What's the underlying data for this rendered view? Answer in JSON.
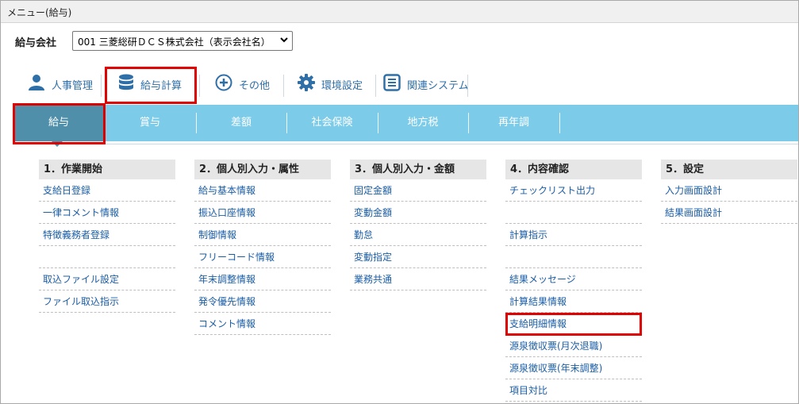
{
  "window": {
    "title": "メニュー(給与)"
  },
  "company": {
    "label": "給与会社",
    "selected": "001 三菱総研ＤＣＳ株式会社（表示会社名）"
  },
  "nav": [
    {
      "label": "人事管理",
      "icon": "person-icon"
    },
    {
      "label": "給与計算",
      "icon": "database-icon"
    },
    {
      "label": "その他",
      "icon": "plus-circle-icon"
    },
    {
      "label": "環境設定",
      "icon": "gear-icon"
    },
    {
      "label": "関連システム",
      "icon": "list-box-icon"
    }
  ],
  "tabs": [
    "給与",
    "賞与",
    "差額",
    "社会保険",
    "地方税",
    "再年調"
  ],
  "columns": [
    {
      "title": "1．作業開始",
      "items": [
        "支給日登録",
        "一律コメント情報",
        "特徴義務者登録",
        "",
        "取込ファイル設定",
        "ファイル取込指示"
      ]
    },
    {
      "title": "2．個人別入力・属性",
      "items": [
        "給与基本情報",
        "振込口座情報",
        "制御情報",
        "フリーコード情報",
        "年末調整情報",
        "発令優先情報",
        "コメント情報"
      ]
    },
    {
      "title": "3．個人別入力・金額",
      "items": [
        "固定金額",
        "変動金額",
        "勤怠",
        "変動指定",
        "業務共通"
      ]
    },
    {
      "title": "4．内容確認",
      "items": [
        "チェックリスト出力",
        "",
        "計算指示",
        "",
        "結果メッセージ",
        "計算結果情報",
        "支給明細情報",
        "源泉徴収票(月次退職)",
        "源泉徴収票(年末調整)",
        "項目対比"
      ]
    },
    {
      "title": "5．設定",
      "items": [
        "入力画面設計",
        "結果画面設計"
      ]
    }
  ],
  "colors": {
    "tab_bar": "#7ccbe8",
    "tab_active": "#4f8fa9",
    "link": "#1a5da6",
    "highlight": "#e00000"
  }
}
